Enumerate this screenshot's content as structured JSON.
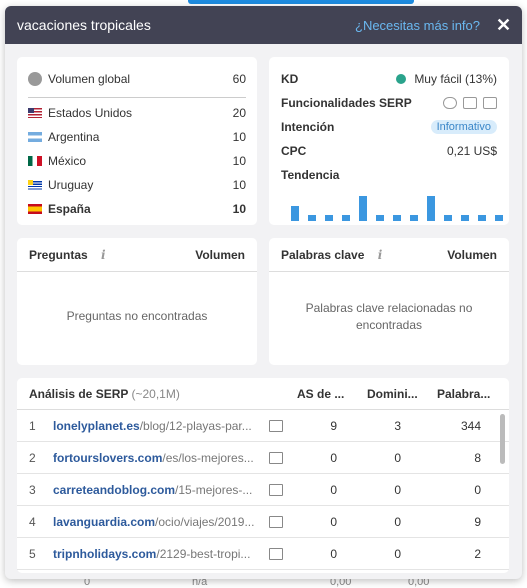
{
  "header": {
    "title": "vacaciones tropicales",
    "more_info": "¿Necesitas más info?",
    "close": "✕"
  },
  "volume": {
    "global": {
      "label": "Volumen global",
      "value": "60"
    },
    "countries": [
      {
        "name": "Estados Unidos",
        "value": "20",
        "flag": "us"
      },
      {
        "name": "Argentina",
        "value": "10",
        "flag": "ar"
      },
      {
        "name": "México",
        "value": "10",
        "flag": "mx"
      },
      {
        "name": "Uruguay",
        "value": "10",
        "flag": "uy"
      },
      {
        "name": "España",
        "value": "10",
        "flag": "es"
      }
    ]
  },
  "metrics": {
    "kd_label": "KD",
    "kd_value": "Muy fácil (13%)",
    "kd_color": "#2aa38c",
    "serp_label": "Funcionalidades SERP",
    "intent_label": "Intención",
    "intent_value": "Informativo",
    "cpc_label": "CPC",
    "cpc_value": "0,21 US$",
    "trend_label": "Tendencia",
    "trend": [
      0.55,
      0.2,
      0.2,
      0.2,
      0.9,
      0.2,
      0.2,
      0.2,
      0.9,
      0.2,
      0.2,
      0.2,
      0.2
    ]
  },
  "questions": {
    "title": "Preguntas",
    "info": "i",
    "col": "Volumen",
    "empty": "Preguntas no encontradas"
  },
  "keywords": {
    "title": "Palabras clave",
    "info": "i",
    "col": "Volumen",
    "empty": "Palabras clave relacionadas no encontradas"
  },
  "serp": {
    "title": "Análisis de SERP",
    "count": "(~20,1M)",
    "cols": [
      "AS de ...",
      "Domini...",
      "Palabra..."
    ],
    "rows": [
      {
        "n": "1",
        "domain": "lonelyplanet.es",
        "path": "/blog/12-playas-par...",
        "as": "9",
        "dom": "3",
        "kw": "344"
      },
      {
        "n": "2",
        "domain": "fortourslovers.com",
        "path": "/es/los-mejores...",
        "as": "0",
        "dom": "0",
        "kw": "8"
      },
      {
        "n": "3",
        "domain": "carreteandoblog.com",
        "path": "/15-mejores-...",
        "as": "0",
        "dom": "0",
        "kw": "0"
      },
      {
        "n": "4",
        "domain": "lavanguardia.com",
        "path": "/ocio/viajes/2019...",
        "as": "0",
        "dom": "0",
        "kw": "9"
      },
      {
        "n": "5",
        "domain": "tripnholidays.com",
        "path": "/2129-best-tropi...",
        "as": "0",
        "dom": "0",
        "kw": "2"
      }
    ]
  },
  "background": {
    "c1": "0",
    "c2": "n/a",
    "c3": "0,00",
    "c4": "0,00"
  }
}
